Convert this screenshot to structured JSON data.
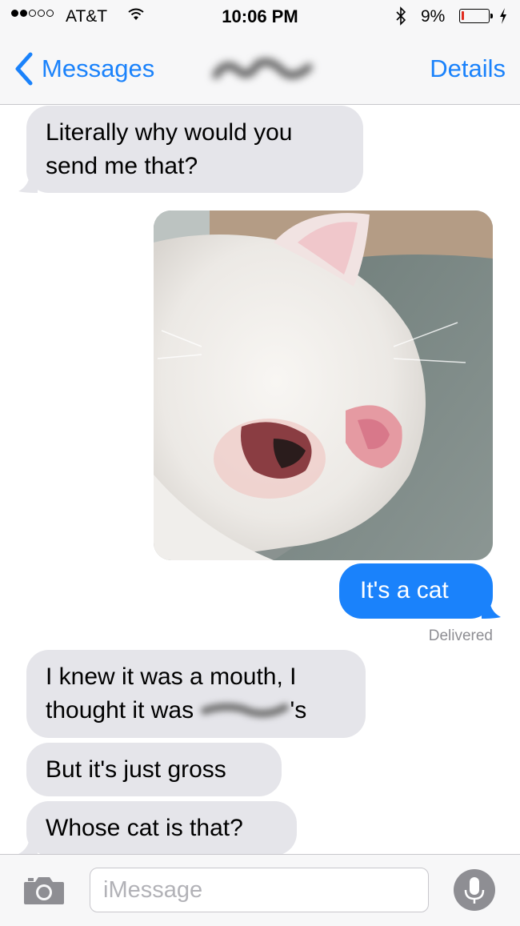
{
  "status_bar": {
    "signal_dots": [
      "on",
      "on",
      "off",
      "off",
      "off"
    ],
    "carrier": "AT&T",
    "time": "10:06 PM",
    "battery_percent": "9%",
    "battery_level": 0.09,
    "icons": [
      "wifi-icon",
      "bluetooth-icon",
      "battery-icon",
      "charging-icon"
    ]
  },
  "nav": {
    "back_label": "Messages",
    "details_label": "Details",
    "contact_name_blurred": true
  },
  "messages": [
    {
      "direction": "received",
      "text_lines": [
        "Literally why would you",
        "send me that?"
      ]
    },
    {
      "direction": "sent",
      "type": "photo",
      "subject": "sleeping white cat with mouth open"
    },
    {
      "direction": "sent",
      "text": "It's a cat",
      "status": "Delivered"
    },
    {
      "direction": "received",
      "text_lines": [
        "I knew it was a mouth, I",
        "thought it was",
        "'s"
      ]
    },
    {
      "direction": "received",
      "text": "But it's just gross"
    },
    {
      "direction": "received",
      "text": "Whose cat is that?"
    }
  ],
  "input": {
    "placeholder": "iMessage",
    "value": ""
  },
  "colors": {
    "accent": "#1a82fb",
    "received_bubble": "#e5e5ea",
    "bar_background": "#f7f7f8",
    "battery_low": "#e02b1f"
  }
}
